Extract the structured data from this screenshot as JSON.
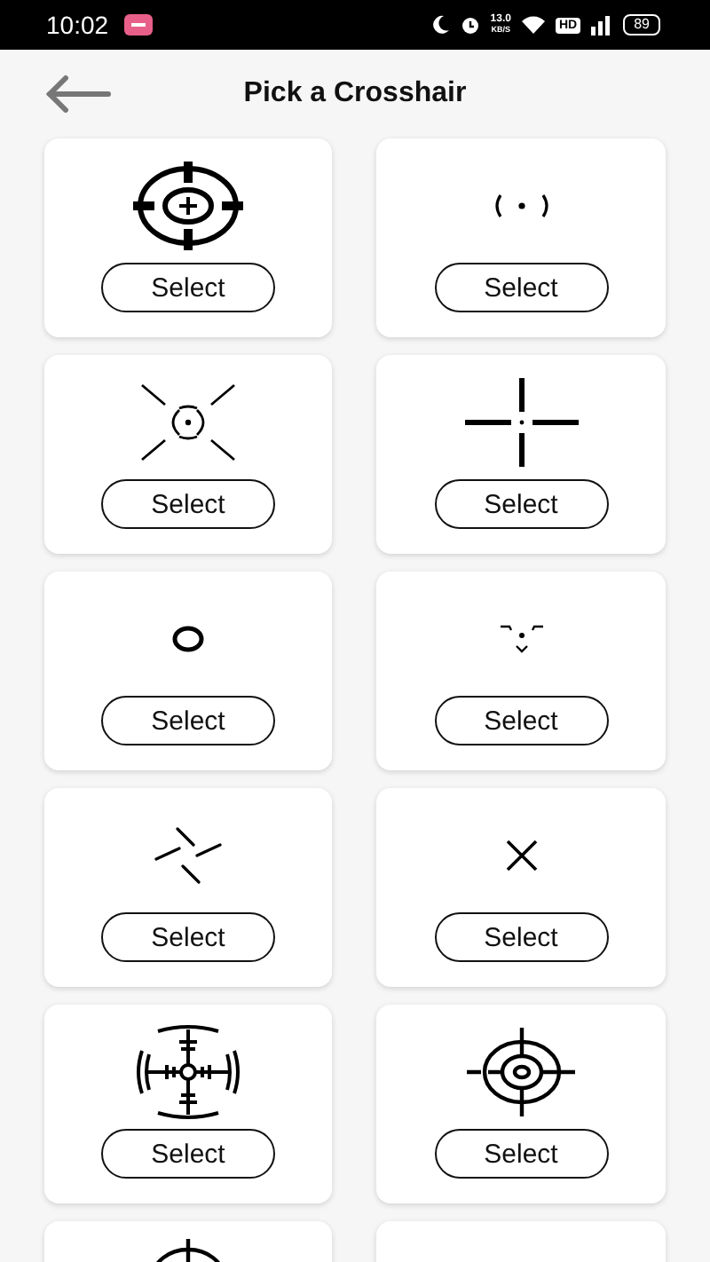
{
  "status_bar": {
    "time": "10:02",
    "speed_value": "13.0",
    "speed_unit": "KB/S",
    "hd": "HD",
    "battery": "89"
  },
  "header": {
    "title": "Pick a Crosshair"
  },
  "crosshairs": [
    {
      "kind": "scope",
      "button": "Select"
    },
    {
      "kind": "dot-brackets",
      "button": "Select"
    },
    {
      "kind": "x-burst",
      "button": "Select"
    },
    {
      "kind": "gap-cross",
      "button": "Select"
    },
    {
      "kind": "ring",
      "button": "Select"
    },
    {
      "kind": "chevrons",
      "button": "Select"
    },
    {
      "kind": "pinwheel",
      "button": "Select"
    },
    {
      "kind": "x-mark",
      "button": "Select"
    },
    {
      "kind": "radar",
      "button": "Select"
    },
    {
      "kind": "bullseye",
      "button": "Select"
    },
    {
      "kind": "circle-cross"
    },
    {
      "kind": "empty"
    }
  ]
}
